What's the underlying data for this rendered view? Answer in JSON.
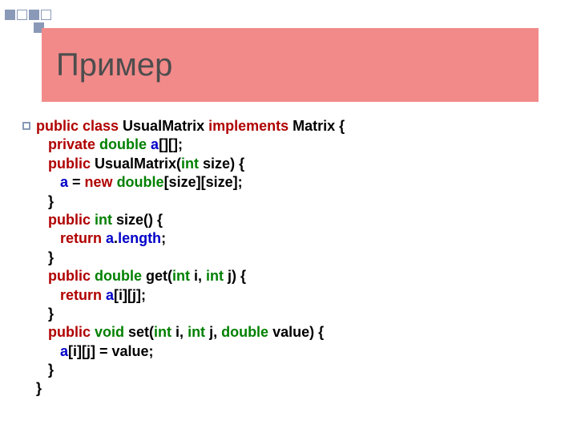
{
  "title": "Пример",
  "code": {
    "l1a": "public",
    "l1b": " class",
    "l1c": " UsualMatrix ",
    "l1d": "implements",
    "l1e": " Matrix {",
    "l2a": "private",
    "l2b": " double",
    "l2c": " a",
    "l2d": "[][];",
    "l3a": "public",
    "l3b": " UsualMatrix(",
    "l3c": "int",
    "l3d": " size) {",
    "l4a": "a",
    "l4b": " = ",
    "l4c": "new",
    "l4d": " double",
    "l4e": "[size][size];",
    "l5": "}",
    "l6a": "public",
    "l6b": " int",
    "l6c": " size() {",
    "l7a": "return",
    "l7b": " a",
    "l7c": ".",
    "l7d": "length",
    "l7e": ";",
    "l8": "}",
    "l9a": "public",
    "l9b": " double",
    "l9c": " get(",
    "l9d": "int",
    "l9e": " i, ",
    "l9f": "int",
    "l9g": " j) {",
    "l10a": "return",
    "l10b": " a",
    "l10c": "[i][j];",
    "l11": "}",
    "l12a": "public",
    "l12b": " void",
    "l12c": " set(",
    "l12d": "int",
    "l12e": " i, ",
    "l12f": "int",
    "l12g": " j, ",
    "l12h": "double",
    "l12i": " value) {",
    "l13a": "a",
    "l13b": "[i][j] = value;",
    "l14": "}",
    "l15": "}"
  }
}
